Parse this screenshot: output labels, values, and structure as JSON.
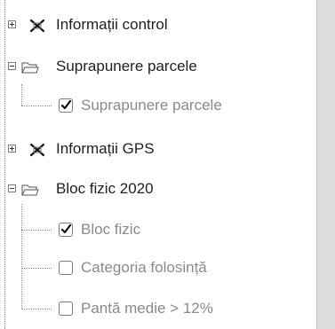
{
  "tree": {
    "items": [
      {
        "label": "Informații control"
      },
      {
        "label": "Suprapunere parcele"
      },
      {
        "label": "Suprapunere parcele"
      },
      {
        "label": "Informații GPS"
      },
      {
        "label": "Bloc fizic 2020"
      },
      {
        "label": "Bloc fizic"
      },
      {
        "label": "Categoria folosință"
      },
      {
        "label": "Pantă medie > 12%"
      }
    ],
    "icons": [
      "disabled-layer-icon",
      "folder-open-icon",
      "checkbox-checked",
      "disabled-layer-icon",
      "folder-open-icon",
      "checkbox-checked",
      "checkbox-unchecked",
      "checkbox-unchecked"
    ],
    "states": {
      "group_informatii_control": "collapsed",
      "group_suprapunere_parcele": "expanded",
      "layer_suprapunere_parcele": "checked",
      "group_informatii_gps": "collapsed",
      "group_bloc_fizic_2020": "expanded",
      "layer_bloc_fizic": "checked",
      "layer_categoria_folosinta": "unchecked",
      "layer_panta_medie": "unchecked"
    }
  }
}
